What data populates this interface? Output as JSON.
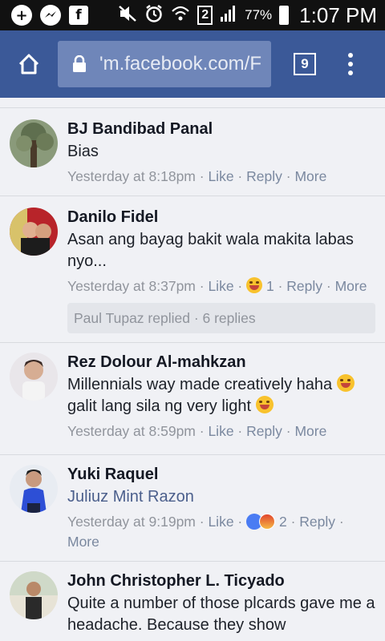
{
  "status_bar": {
    "battery": "77%",
    "time": "1:07 PM",
    "sim": "2",
    "icons": [
      "plus-icon",
      "messenger-icon",
      "facebook-icon",
      "mute-icon",
      "alarm-icon",
      "wifi-icon",
      "signal-icon",
      "battery-icon"
    ]
  },
  "browser": {
    "url": "'m.facebook.com/F",
    "tab_count": "9"
  },
  "comments": [
    {
      "name": "BJ Bandibad Panal",
      "text": "Bias",
      "time": "Yesterday at 8:18pm",
      "like": "Like",
      "reply": "Reply",
      "more": "More"
    },
    {
      "name": "Danilo Fidel",
      "text": "Asan ang bayag bakit wala makita labas nyo...",
      "time": "Yesterday at 8:37pm",
      "like": "Like",
      "reaction_count": "1",
      "reply": "Reply",
      "more": "More",
      "replies_summary": "Paul Tupaz replied · 6 replies"
    },
    {
      "name": "Rez Dolour Al-mahkzan",
      "text_line1": "Millennials way made creatively haha",
      "text_line2": "galit lang sila ng very light",
      "time": "Yesterday at 8:59pm",
      "like": "Like",
      "reply": "Reply",
      "more": "More"
    },
    {
      "name": "Yuki Raquel",
      "text": "Juliuz Mint Razon",
      "time": "Yesterday at 9:19pm",
      "like": "Like",
      "reaction_count": "2",
      "reply": "Reply",
      "more": "More"
    },
    {
      "name": "John Christopher L. Ticyado",
      "text": "Quite a number of those plcards gave me a headache. Because they show"
    }
  ],
  "colors": {
    "brand": "#3b5998",
    "background": "#f0f1f5",
    "link": "#4b5f8c"
  }
}
